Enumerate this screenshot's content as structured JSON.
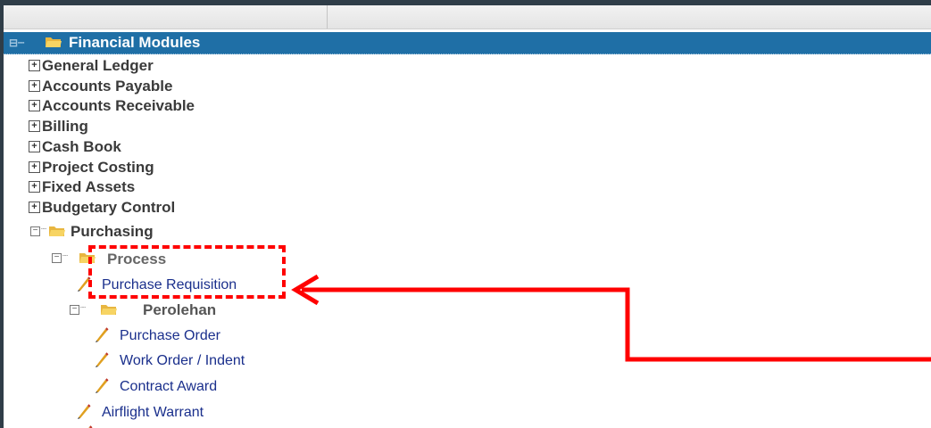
{
  "tree": {
    "root_label": "Financial Modules",
    "categories": [
      "General Ledger",
      "Accounts Payable",
      "Accounts Receivable",
      "Billing",
      "Cash Book",
      "Project Costing",
      "Fixed Assets",
      "Budgetary Control"
    ],
    "purchasing_label": "Purchasing",
    "process_label": "Process",
    "purchase_requisition_label": "Purchase Requisition",
    "perolehan_label": "Perolehan",
    "perolehan_items": [
      "Purchase Order",
      "Work Order / Indent",
      "Contract Award"
    ],
    "airflight_label": "Airflight Warrant"
  },
  "annotation": {
    "highlight_color": "#ff0000"
  }
}
